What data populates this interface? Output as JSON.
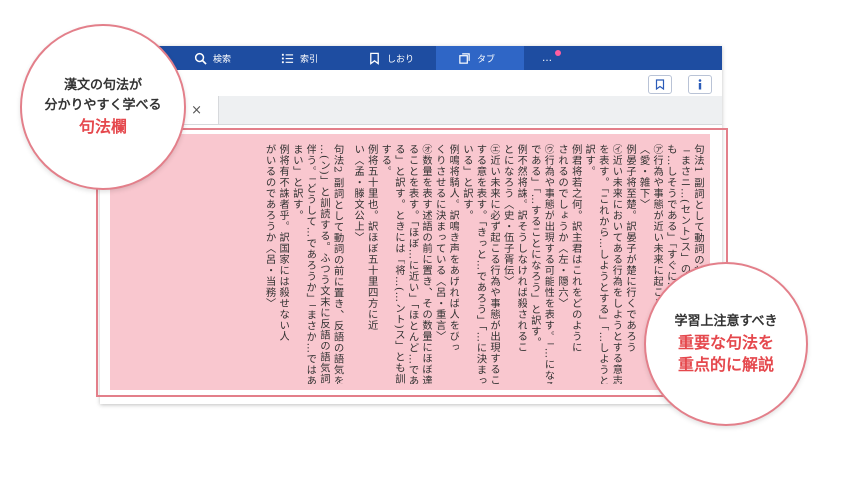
{
  "toolbar": {
    "items": [
      {
        "label": "検索",
        "icon": "search-icon"
      },
      {
        "label": "索引",
        "icon": "list-icon"
      },
      {
        "label": "しおり",
        "icon": "bookmark-icon"
      },
      {
        "label": "タブ",
        "icon": "tabs-icon"
      },
      {
        "label": "…",
        "icon": "more-icon"
      }
    ]
  },
  "tab": {
    "close": "×"
  },
  "callouts": {
    "left": {
      "line1": "漢文の句法が",
      "line2": "分かりやすく学べる",
      "highlight": "句法欄"
    },
    "right": {
      "line1": "学習上注意すべき",
      "line2": "重要な句法を",
      "line3": "重点的に解説"
    }
  },
  "page": {
    "columns": [
      "句法1 副詞として動詞の前に置き、基本",
      "「まさニ…(セント)ス」の形で再読す",
      "も…しそうである」「すぐに…しよう」など訳す。",
      "㋐行為や事態が近い未来に起こる意を表す",
      "〈愛・雑下〉",
      "例晏子将至楚。訳晏子が楚に行くであろう",
      "㋑近い未来においてある行為をしようとする意志や意欲",
      "を表す。「これから…しようとする」「…しようとする」と",
      "訳す。",
      "例君将若之何。訳主君はこれをどのように",
      "されるのでしょうか〈左・隠六〉",
      "㋒行為や事態が出現する可能性を表す。「…になるはず",
      "である」「…することになろう」と訳す。",
      "例不然将誅。訳そうしなければ殺されるこ",
      "とになろう〈史・伍子胥伝〉",
      "㋓近い未来に必ず起こる行為や事態が出現することを強調",
      "する意を表す。「きっと…であろう」「…に決まって",
      "いる」と訳す。",
      "例鳴将騎人。訳鳴き声をあげれば人をびっ",
      "くりさせるに決まっている〈呂・重言〉",
      "㋔数量を表す述語の前に置き、その数量にほぼ達してい",
      "ることを表す。「ほぼ…に近い」「ほとんど…であ",
      "る」と訳す。ときには「将…(…ント)ス」とも訓読",
      "する。",
      "例将五十里也。訳ほぼ五十里四方に近",
      "い〈孟・滕文公上〉",
      "",
      "句法2 副詞として動詞の前に置き、反語の語気を強調する。「",
      "…(ン)」と訓読する。ふつう文末に反語の語気詞「乎」を",
      "伴う。「どうして…であろうか」「まさか…ではある",
      "まい」と訳す。",
      "例将有不誅者乎。訳国家には殺せない人",
      "がいるのであろうか〈呂・当務〉"
    ]
  }
}
